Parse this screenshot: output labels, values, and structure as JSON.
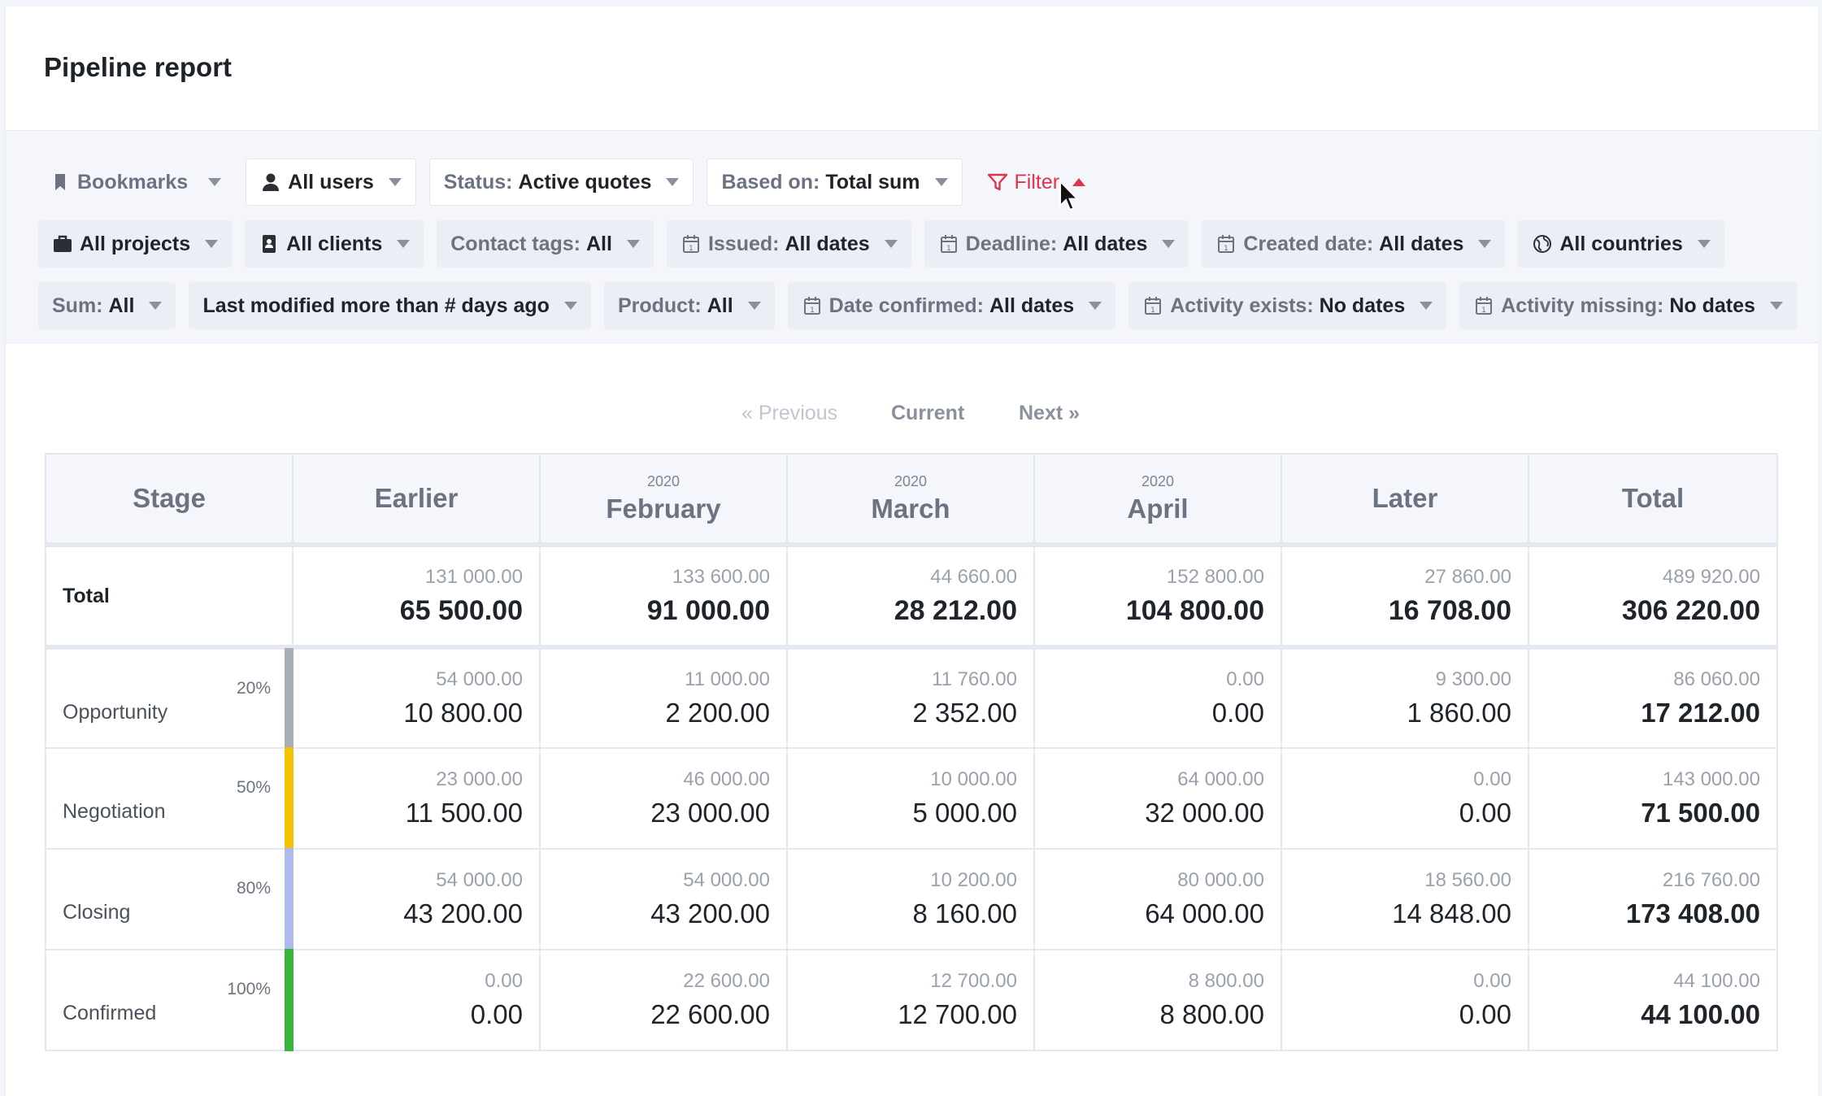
{
  "page": {
    "title": "Pipeline report"
  },
  "filters": {
    "row1": [
      {
        "name": "bookmarks-filter",
        "icon": "bookmark-icon",
        "label": "Bookmarks",
        "value": "",
        "style": "plain"
      },
      {
        "name": "users-filter",
        "icon": "user-icon",
        "label": "",
        "value": "All users",
        "style": "white"
      },
      {
        "name": "status-filter",
        "icon": "",
        "label": "Status:",
        "value": "Active quotes",
        "style": "white"
      },
      {
        "name": "based-on-filter",
        "icon": "",
        "label": "Based on:",
        "value": "Total sum",
        "style": "white"
      },
      {
        "name": "filter-toggle",
        "icon": "funnel-icon",
        "label": "",
        "value": "Filter",
        "style": "filter"
      }
    ],
    "row2": [
      {
        "name": "projects-filter",
        "icon": "briefcase-icon",
        "label": "",
        "value": "All projects"
      },
      {
        "name": "clients-filter",
        "icon": "contact-book-icon",
        "label": "",
        "value": "All clients"
      },
      {
        "name": "contact-tags-filter",
        "icon": "",
        "label": "Contact tags:",
        "value": "All"
      },
      {
        "name": "issued-filter",
        "icon": "calendar-icon",
        "label": "Issued:",
        "value": "All dates"
      },
      {
        "name": "deadline-filter",
        "icon": "calendar-icon",
        "label": "Deadline:",
        "value": "All dates"
      },
      {
        "name": "created-date-filter",
        "icon": "calendar-icon",
        "label": "Created date:",
        "value": "All dates"
      },
      {
        "name": "countries-filter",
        "icon": "globe-icon",
        "label": "",
        "value": "All countries"
      }
    ],
    "row3": [
      {
        "name": "sum-filter",
        "icon": "",
        "label": "Sum:",
        "value": "All"
      },
      {
        "name": "last-modified-filter",
        "icon": "",
        "label": "",
        "value": "Last modified more than # days ago"
      },
      {
        "name": "product-filter",
        "icon": "",
        "label": "Product:",
        "value": "All"
      },
      {
        "name": "date-confirmed-filter",
        "icon": "calendar-icon",
        "label": "Date confirmed:",
        "value": "All dates"
      },
      {
        "name": "activity-exists-filter",
        "icon": "calendar-icon",
        "label": "Activity exists:",
        "value": "No dates"
      },
      {
        "name": "activity-missing-filter",
        "icon": "calendar-icon",
        "label": "Activity missing:",
        "value": "No dates"
      }
    ]
  },
  "pager": {
    "previous": "« Previous",
    "current": "Current",
    "next": "Next »"
  },
  "table": {
    "columns": [
      {
        "year": "",
        "label": "Stage"
      },
      {
        "year": "",
        "label": "Earlier"
      },
      {
        "year": "2020",
        "label": "February"
      },
      {
        "year": "2020",
        "label": "March"
      },
      {
        "year": "2020",
        "label": "April"
      },
      {
        "year": "",
        "label": "Later"
      },
      {
        "year": "",
        "label": "Total"
      }
    ],
    "total_row": {
      "label": "Total",
      "cells": [
        {
          "sub": "131 000.00",
          "main": "65 500.00"
        },
        {
          "sub": "133 600.00",
          "main": "91 000.00"
        },
        {
          "sub": "44 660.00",
          "main": "28 212.00"
        },
        {
          "sub": "152 800.00",
          "main": "104 800.00"
        },
        {
          "sub": "27 860.00",
          "main": "16 708.00"
        },
        {
          "sub": "489 920.00",
          "main": "306 220.00"
        }
      ]
    },
    "stages": [
      {
        "name": "Opportunity",
        "pct": "20%",
        "color": "#a9aeb9",
        "cells": [
          {
            "sub": "54 000.00",
            "main": "10 800.00"
          },
          {
            "sub": "11 000.00",
            "main": "2 200.00"
          },
          {
            "sub": "11 760.00",
            "main": "2 352.00"
          },
          {
            "sub": "0.00",
            "main": "0.00"
          },
          {
            "sub": "9 300.00",
            "main": "1 860.00"
          },
          {
            "sub": "86 060.00",
            "main": "17 212.00"
          }
        ]
      },
      {
        "name": "Negotiation",
        "pct": "50%",
        "color": "#f2c200",
        "cells": [
          {
            "sub": "23 000.00",
            "main": "11 500.00"
          },
          {
            "sub": "46 000.00",
            "main": "23 000.00"
          },
          {
            "sub": "10 000.00",
            "main": "5 000.00"
          },
          {
            "sub": "64 000.00",
            "main": "32 000.00"
          },
          {
            "sub": "0.00",
            "main": "0.00"
          },
          {
            "sub": "143 000.00",
            "main": "71 500.00"
          }
        ]
      },
      {
        "name": "Closing",
        "pct": "80%",
        "color": "#b0b8f0",
        "cells": [
          {
            "sub": "54 000.00",
            "main": "43 200.00"
          },
          {
            "sub": "54 000.00",
            "main": "43 200.00"
          },
          {
            "sub": "10 200.00",
            "main": "8 160.00"
          },
          {
            "sub": "80 000.00",
            "main": "64 000.00"
          },
          {
            "sub": "18 560.00",
            "main": "14 848.00"
          },
          {
            "sub": "216 760.00",
            "main": "173 408.00"
          }
        ]
      },
      {
        "name": "Confirmed",
        "pct": "100%",
        "color": "#3cb43c",
        "cells": [
          {
            "sub": "0.00",
            "main": "0.00"
          },
          {
            "sub": "22 600.00",
            "main": "22 600.00"
          },
          {
            "sub": "12 700.00",
            "main": "12 700.00"
          },
          {
            "sub": "8 800.00",
            "main": "8 800.00"
          },
          {
            "sub": "0.00",
            "main": "0.00"
          },
          {
            "sub": "44 100.00",
            "main": "44 100.00"
          }
        ]
      }
    ]
  }
}
